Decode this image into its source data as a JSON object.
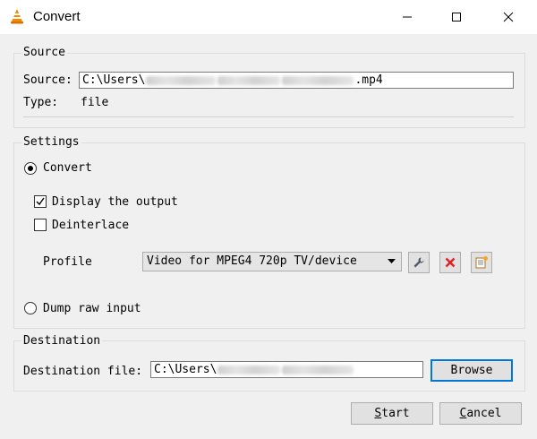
{
  "window": {
    "title": "Convert",
    "icon": "vlc-cone-icon",
    "controls": [
      "minimize-icon",
      "maximize-icon",
      "close-icon"
    ]
  },
  "source": {
    "group_title": "Source",
    "source_label": "Source:",
    "path_prefix": "C:\\Users\\",
    "path_suffix": ".mp4",
    "type_label": "Type:",
    "type_value": "file"
  },
  "settings": {
    "group_title": "Settings",
    "convert_label": "Convert",
    "convert_selected": true,
    "display_output_label": "Display the output",
    "display_output_checked": true,
    "deinterlace_label": "Deinterlace",
    "deinterlace_checked": false,
    "profile_label": "Profile",
    "profile_value": "Video for MPEG4 720p TV/device",
    "profile_tools": [
      "wrench-icon",
      "delete-icon",
      "new-profile-icon"
    ],
    "dump_raw_label": "Dump raw input",
    "dump_raw_selected": false
  },
  "destination": {
    "group_title": "Destination",
    "file_label": "Destination file:",
    "path_prefix": "C:\\Users\\",
    "browse_label": "Browse"
  },
  "footer": {
    "start_first": "S",
    "start_rest": "tart",
    "cancel_first": "C",
    "cancel_rest": "ancel"
  },
  "colors": {
    "accent": "#0078d7",
    "delete_red": "#e02020",
    "vlc_orange": "#f08a00"
  }
}
